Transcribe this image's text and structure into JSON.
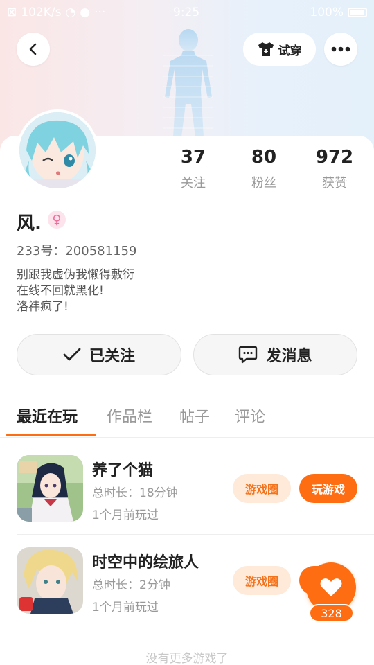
{
  "status_bar": {
    "network_speed": "102K/s",
    "time": "9:25",
    "battery": "100%"
  },
  "header": {
    "tryon_label": "试穿"
  },
  "profile": {
    "stats": [
      {
        "value": "37",
        "label": "关注"
      },
      {
        "value": "80",
        "label": "粉丝"
      },
      {
        "value": "972",
        "label": "获赞"
      }
    ],
    "name": "风.",
    "gender_symbol": "♀",
    "uid_label": "233号：200581159",
    "bio": [
      "别跟我虚伪我懒得敷衍",
      "在线不回就黑化!",
      "洛祎疯了!"
    ]
  },
  "actions": {
    "follow_label": "已关注",
    "message_label": "发消息"
  },
  "tabs": [
    "最近在玩",
    "作品栏",
    "帖子",
    "评论"
  ],
  "games": [
    {
      "title": "养了个猫",
      "duration": "总时长：18分钟",
      "last_played": "1个月前玩过",
      "circle_label": "游戏圈",
      "play_label": "玩游戏"
    },
    {
      "title": "时空中的绘旅人",
      "duration": "总时长：2分钟",
      "last_played": "1个月前玩过",
      "circle_label": "游戏圈"
    }
  ],
  "fab": {
    "count": "328"
  },
  "footer_text": "没有更多游戏了",
  "colors": {
    "accent": "#ff6d13",
    "accent_light": "#ffe9d8"
  }
}
